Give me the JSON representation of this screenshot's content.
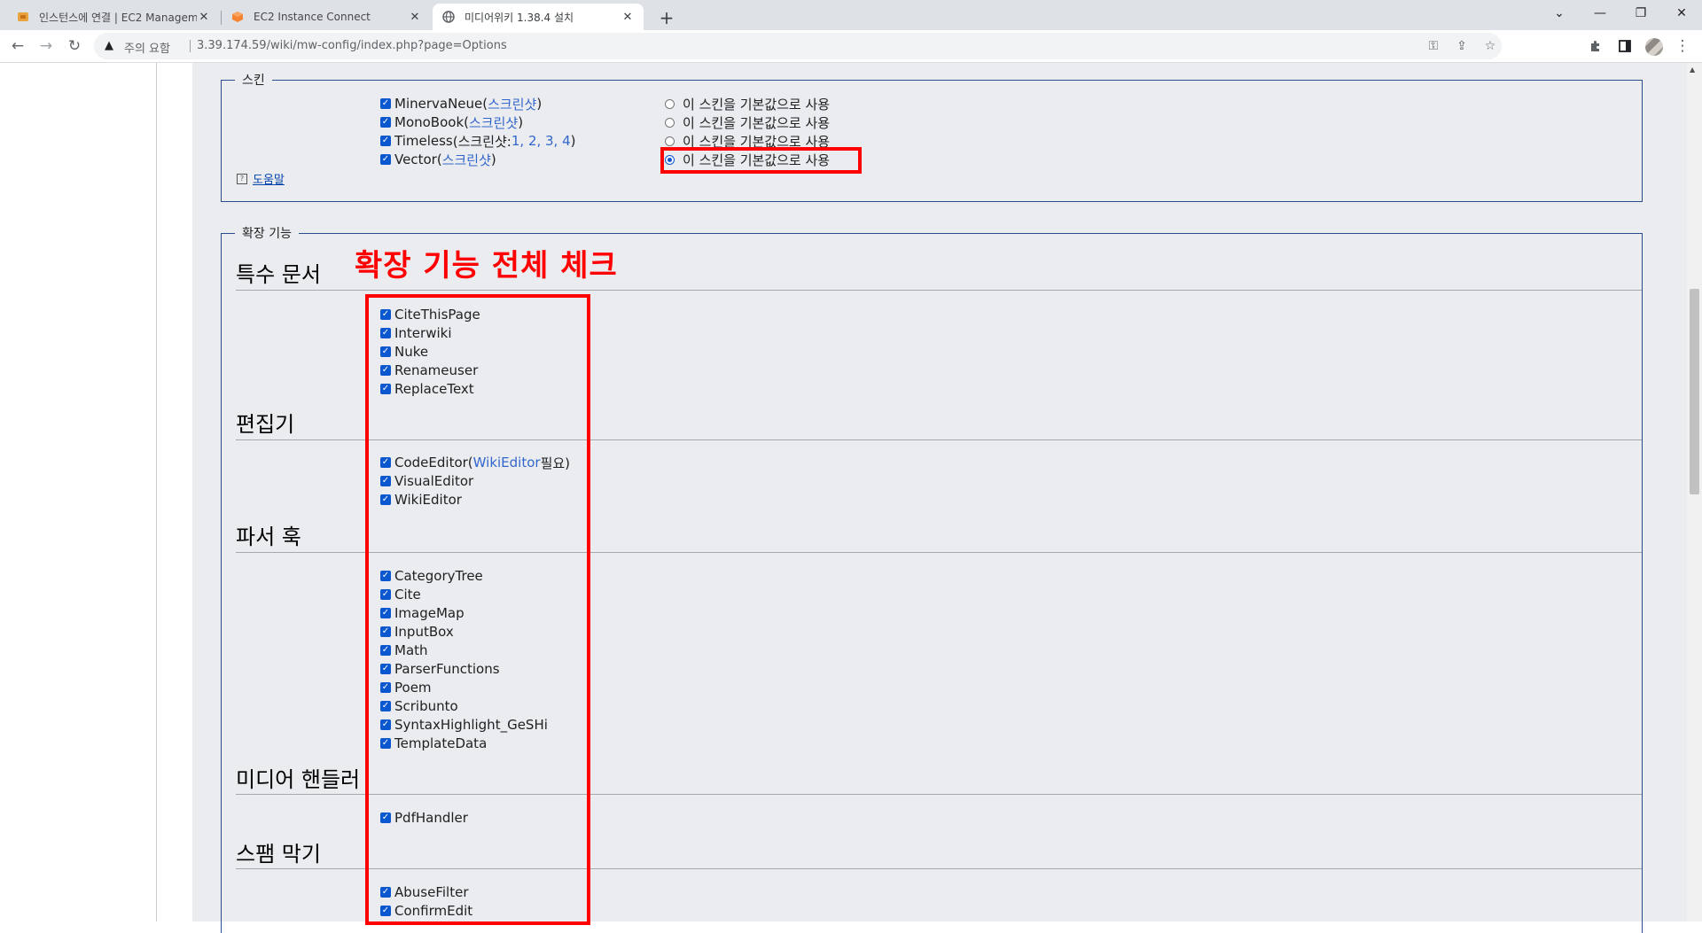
{
  "browser": {
    "tabs": [
      {
        "title": "인스턴스에 연결 | EC2 Managem",
        "favicon": "aws-icon"
      },
      {
        "title": "EC2 Instance Connect",
        "favicon": "aws-orange-icon"
      },
      {
        "title": "미디어위키 1.38.4 설치",
        "favicon": "globe-icon"
      }
    ],
    "omnibox": {
      "security_label": "주의 요함",
      "url": "3.39.174.59/wiki/mw-config/index.php?page=Options"
    }
  },
  "skins": {
    "legend": "스킨",
    "items": [
      {
        "name": "MinervaNeue",
        "open": " (",
        "link": "스크린샷",
        "tail": ")"
      },
      {
        "name": "MonoBook",
        "open": " (",
        "link": "스크린샷",
        "tail": ")"
      },
      {
        "name": "Timeless",
        "open": " (스크린샷: ",
        "link": "1, 2, 3, 4",
        "tail": ")"
      },
      {
        "name": "Vector",
        "open": " (",
        "link": "스크린샷",
        "tail": ")"
      }
    ],
    "default_label": "이 스킨을 기본값으로 사용",
    "selected_default_index": 3,
    "help_label": "도움말"
  },
  "extensions": {
    "legend": "확장 기능",
    "annotation": "확장 기능 전체 체크",
    "sections": [
      {
        "title": "특수 문서",
        "items": [
          "CiteThisPage",
          "Interwiki",
          "Nuke",
          "Renameuser",
          "ReplaceText"
        ]
      },
      {
        "title": "편집기",
        "items": [
          "CodeEditor",
          "VisualEditor",
          "WikiEditor"
        ],
        "code_editor_requires": {
          "open": " (",
          "link": "WikiEditor",
          "tail": " 필요)"
        }
      },
      {
        "title": "파서 훅",
        "items": [
          "CategoryTree",
          "Cite",
          "ImageMap",
          "InputBox",
          "Math",
          "ParserFunctions",
          "Poem",
          "Scribunto",
          "SyntaxHighlight_GeSHi",
          "TemplateData"
        ]
      },
      {
        "title": "미디어 핸들러",
        "items": [
          "PdfHandler"
        ]
      },
      {
        "title": "스팸 막기",
        "items": [
          "AbuseFilter",
          "ConfirmEdit"
        ]
      }
    ]
  }
}
